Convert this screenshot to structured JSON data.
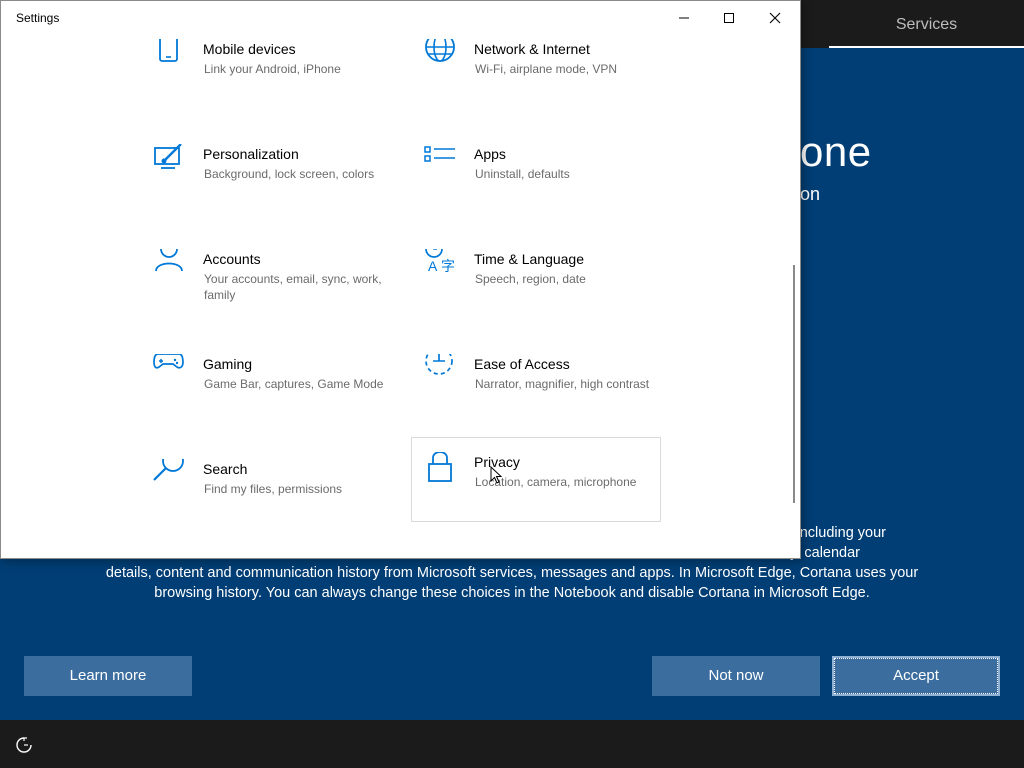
{
  "oobe": {
    "tab_label": "Services",
    "heading_fragment": "one",
    "subheading_fragment": "on",
    "text_line1": "mation including your",
    "text_line2": "n history, calendar",
    "text_line3": "details, content and communication history from Microsoft services, messages and apps. In Microsoft Edge, Cortana uses your",
    "text_line4": "browsing history. You can always change these choices in the Notebook and disable Cortana in Microsoft Edge.",
    "buttons": {
      "learn_more": "Learn more",
      "not_now": "Not now",
      "accept": "Accept"
    },
    "ease_icon": "ease-of-access-icon"
  },
  "window": {
    "title": "Settings",
    "controls": [
      "minimize-icon",
      "maximize-icon",
      "close-icon"
    ]
  },
  "tiles": [
    {
      "name": "Mobile devices",
      "desc": "Link your Android, iPhone",
      "icon": "phone-icon"
    },
    {
      "name": "Network & Internet",
      "desc": "Wi-Fi, airplane mode, VPN",
      "icon": "globe-icon"
    },
    {
      "name": "Personalization",
      "desc": "Background, lock screen, colors",
      "icon": "paint-brush-icon"
    },
    {
      "name": "Apps",
      "desc": "Uninstall, defaults",
      "icon": "apps-list-icon"
    },
    {
      "name": "Accounts",
      "desc": "Your accounts, email, sync, work, family",
      "icon": "person-icon"
    },
    {
      "name": "Time & Language",
      "desc": "Speech, region, date",
      "icon": "time-language-icon"
    },
    {
      "name": "Gaming",
      "desc": "Game Bar, captures, Game Mode",
      "icon": "gamepad-icon"
    },
    {
      "name": "Ease of Access",
      "desc": "Narrator, magnifier, high contrast",
      "icon": "ease-of-access-icon"
    },
    {
      "name": "Search",
      "desc": "Find my files, permissions",
      "icon": "search-icon"
    },
    {
      "name": "Privacy",
      "desc": "Location, camera, microphone",
      "icon": "lock-icon"
    }
  ],
  "colors": {
    "accent": "#0078d7",
    "oobe_bg": "#003e75",
    "button_bg": "#3b6e9f"
  }
}
